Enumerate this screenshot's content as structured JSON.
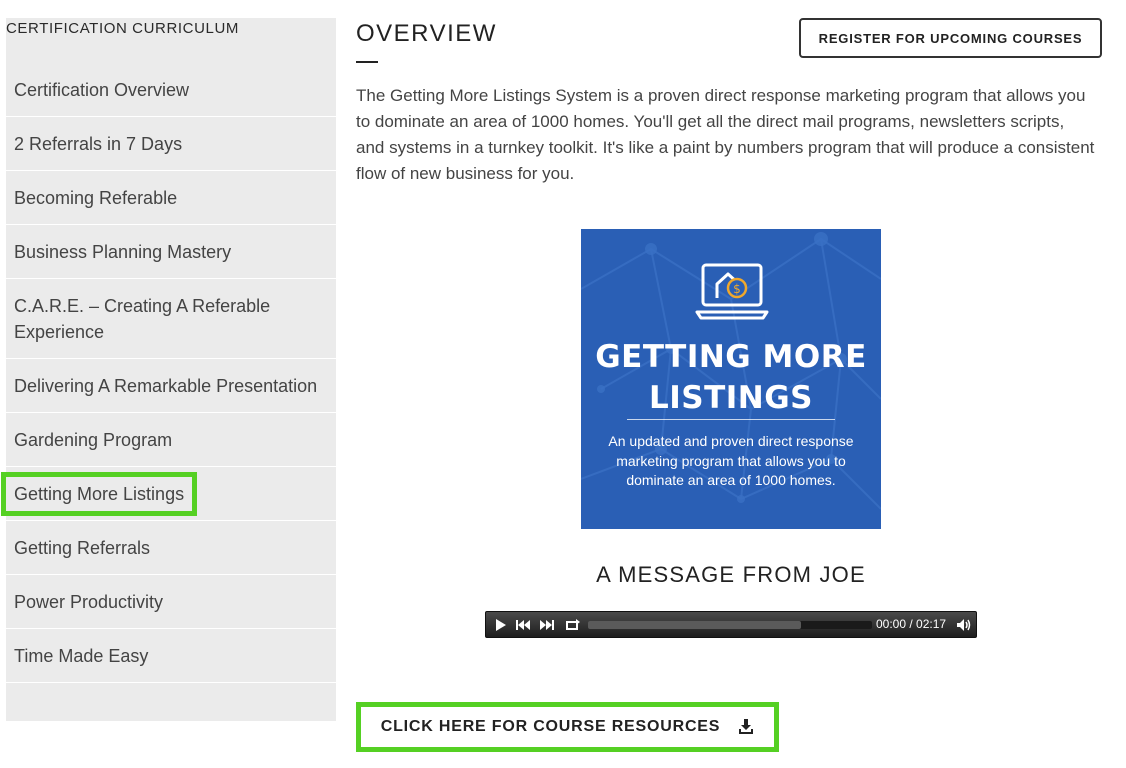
{
  "sidebar": {
    "title": "CERTIFICATION CURRICULUM",
    "items": [
      {
        "label": "Certification Overview"
      },
      {
        "label": "2 Referrals in 7 Days"
      },
      {
        "label": "Becoming Referable"
      },
      {
        "label": "Business Planning Mastery"
      },
      {
        "label": "C.A.R.E. – Creating A Referable Experience"
      },
      {
        "label": "Delivering A Remarkable Presentation"
      },
      {
        "label": "Gardening Program"
      },
      {
        "label": "Getting More Listings",
        "active": true
      },
      {
        "label": "Getting Referrals"
      },
      {
        "label": "Power Productivity"
      },
      {
        "label": "Time Made Easy"
      }
    ]
  },
  "main": {
    "title": "OVERVIEW",
    "register_label": "REGISTER FOR UPCOMING COURSES",
    "description": "The Getting More Listings System is a proven direct response marketing program that allows you to dominate an area of 1000 homes. You'll get all the direct mail programs, newsletters scripts, and systems in a turnkey toolkit. It's like a paint by numbers program that will produce a consistent flow of new business for you.",
    "promo": {
      "title_line1": "GETTING MORE",
      "title_line2": "LISTINGS",
      "subtitle": "An updated and proven direct response marketing program that allows you to dominate an area of 1000 homes.",
      "icon": "laptop-house-dollar-icon",
      "background_color": "#2a5fb5"
    },
    "message_title": "A MESSAGE FROM JOE",
    "player": {
      "time_display": "00:00 / 02:17",
      "loaded_fraction": 0.75,
      "icons": [
        "play-icon",
        "rewind-icon",
        "fast-forward-icon",
        "loop-icon",
        "volume-icon"
      ]
    },
    "resources_label": "CLICK HERE FOR COURSE RESOURCES",
    "resources_icon": "download-icon"
  },
  "colors": {
    "highlight": "#55d023",
    "sidebar_bg": "#ebebeb",
    "promo_bg": "#2a5fb5"
  }
}
